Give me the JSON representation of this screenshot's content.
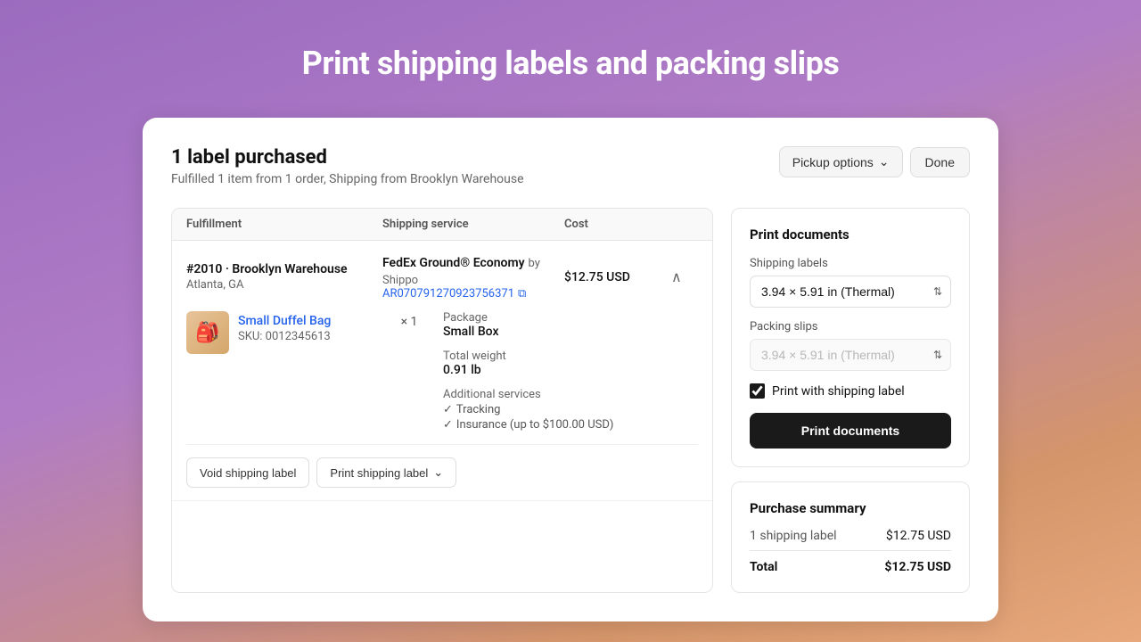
{
  "page": {
    "title": "Print shipping labels and packing slips"
  },
  "header": {
    "labels_purchased": "1 label purchased",
    "subtitle": "Fulfilled 1 item from 1 order, Shipping from Brooklyn Warehouse",
    "pickup_options_label": "Pickup options",
    "done_label": "Done"
  },
  "table": {
    "columns": [
      "Fulfillment",
      "Shipping service",
      "Cost",
      ""
    ],
    "row": {
      "fulfillment_name": "#2010 · Brooklyn Warehouse",
      "fulfillment_location": "Atlanta, GA",
      "shipping_service": "FedEx Ground® Economy",
      "shipping_provider": "by Shippo",
      "tracking_number": "AR070791270923756371",
      "cost": "$12.75 USD",
      "item_name": "Small Duffel Bag",
      "item_sku": "SKU: 0012345613",
      "item_qty": "× 1",
      "package_label": "Package",
      "package_value": "Small Box",
      "weight_label": "Total weight",
      "weight_value": "0.91 lb",
      "additional_label": "Additional services",
      "service1": "Tracking",
      "service2": "Insurance (up to $100.00 USD)",
      "void_label": "Void shipping label",
      "print_label": "Print shipping label"
    }
  },
  "print_panel": {
    "title": "Print documents",
    "shipping_labels_label": "Shipping labels",
    "shipping_labels_value": "3.94 × 5.91 in (Thermal)",
    "packing_slips_label": "Packing slips",
    "packing_slips_value": "3.94 × 5.91 in (Thermal)",
    "packing_slips_disabled": true,
    "checkbox_label": "Print with shipping label",
    "checkbox_checked": true,
    "print_button_label": "Print documents"
  },
  "purchase_summary": {
    "title": "Purchase summary",
    "label1": "1 shipping label",
    "value1": "$12.75 USD",
    "total_label": "Total",
    "total_value": "$12.75 USD"
  },
  "icons": {
    "chevron_down": "⌄",
    "chevron_up": "∧",
    "copy": "⧉",
    "check": "✓"
  }
}
